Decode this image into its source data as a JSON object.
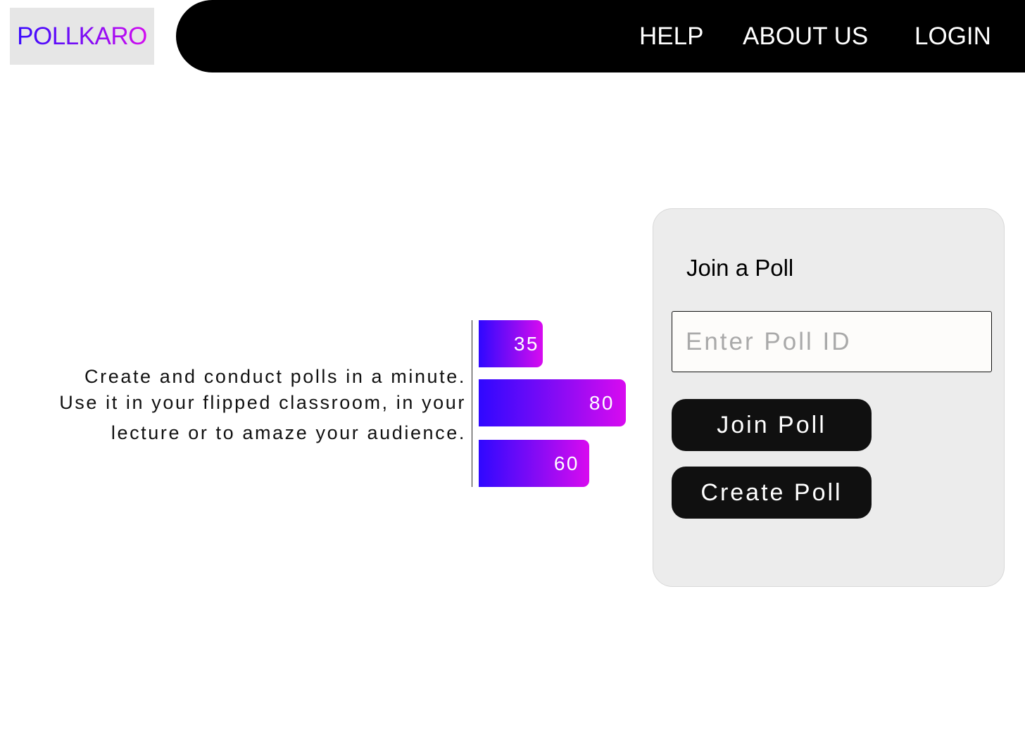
{
  "header": {
    "brand": "POLLKARO",
    "nav": {
      "help": "HELP",
      "about": "ABOUT US",
      "login": "LOGIN"
    }
  },
  "hero": {
    "tagline": [
      "Create and conduct polls in a minute.",
      "Use it in your flipped classroom, in your",
      "lecture or to amaze your audience."
    ]
  },
  "chart_data": {
    "type": "bar",
    "orientation": "horizontal",
    "values": [
      35,
      80,
      60
    ],
    "value_labels": [
      "35",
      "80",
      "60"
    ],
    "xlim": [
      0,
      80
    ],
    "grid": false
  },
  "join_card": {
    "title": "Join a Poll",
    "input_placeholder": "Enter Poll ID",
    "input_value": "",
    "join_button": "Join Poll",
    "create_button": "Create Poll"
  },
  "colors": {
    "gradient_start": "#2f08ff",
    "gradient_end": "#d80bf0",
    "navbar": "#000000",
    "card_background": "#ececec",
    "button": "#101010"
  }
}
